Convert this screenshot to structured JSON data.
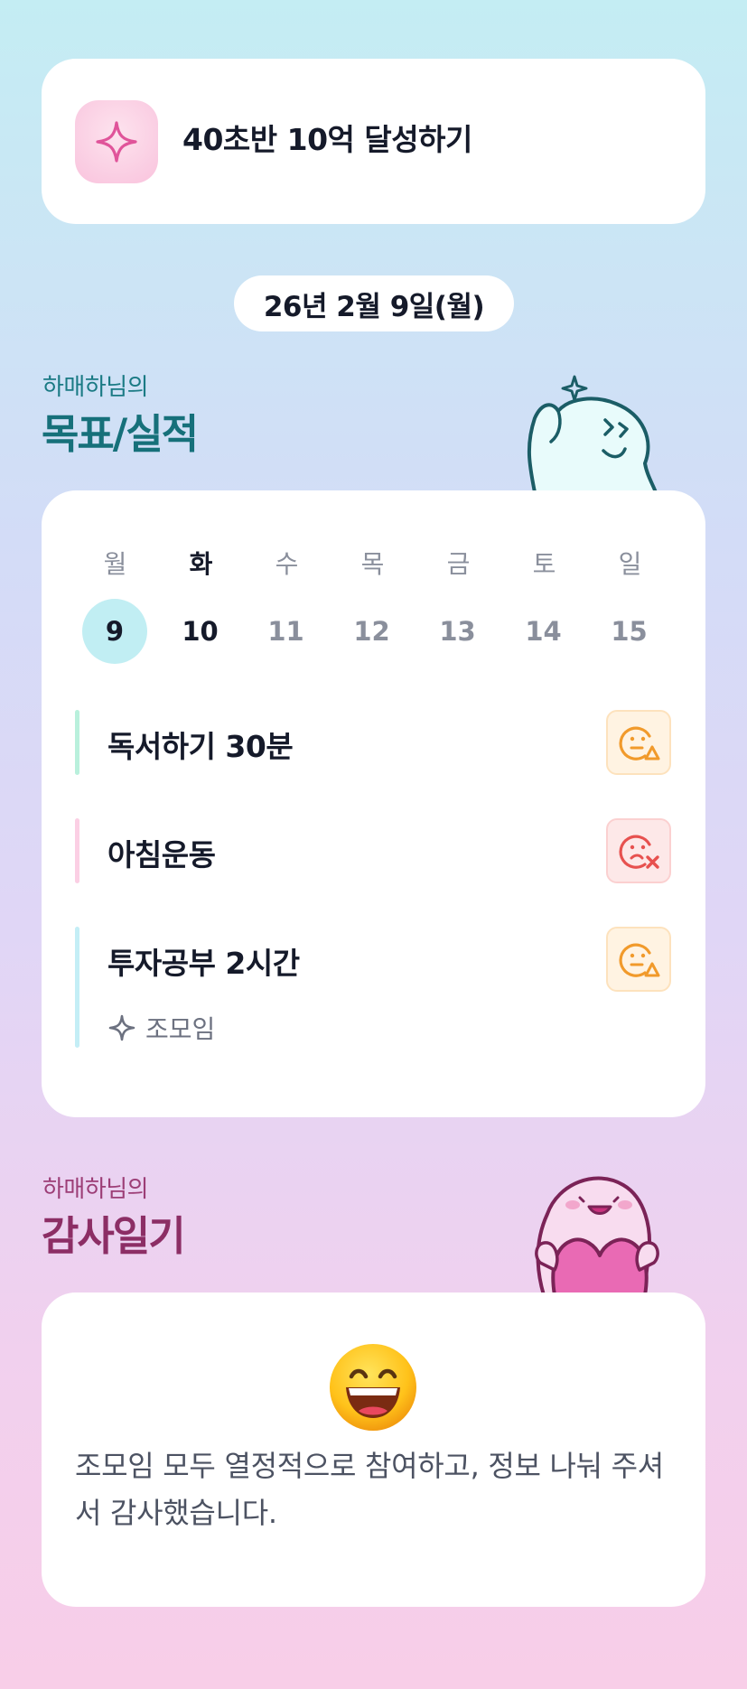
{
  "goal": {
    "text": "40초반 10억 달성하기",
    "icon": "sparkle-icon"
  },
  "date": "26년 2월 9일(월)",
  "goals_section": {
    "subtitle": "하매하님의",
    "title": "목표/실적"
  },
  "week": {
    "days": [
      "월",
      "화",
      "수",
      "목",
      "금",
      "토",
      "일"
    ],
    "dates": [
      "9",
      "10",
      "11",
      "12",
      "13",
      "14",
      "15"
    ],
    "selected_index": 0
  },
  "tasks": [
    {
      "label": "독서하기 30분",
      "bar_color": "#b9f0dc",
      "status": "partial",
      "status_icon": "face-triangle-icon"
    },
    {
      "label": "아침운동",
      "bar_color": "#fbcfe4",
      "status": "failed",
      "status_icon": "face-x-icon"
    },
    {
      "label": "투자공부 2시간",
      "bar_color": "#c4eef6",
      "status": "partial",
      "status_icon": "face-triangle-icon",
      "tag": "조모임"
    }
  ],
  "diary_section": {
    "subtitle": "하매하님의",
    "title": "감사일기"
  },
  "diary": {
    "emoji": "grinning-face-icon",
    "text": "조모임 모두 열정적으로 참여하고, 정보 나눠 주셔서 감사했습니다."
  },
  "colors": {
    "accent_teal": "#16707a",
    "accent_plum": "#8c2e65",
    "warn": "#f19a2b",
    "fail": "#e7514f",
    "today_circle": "#c1eef3"
  }
}
